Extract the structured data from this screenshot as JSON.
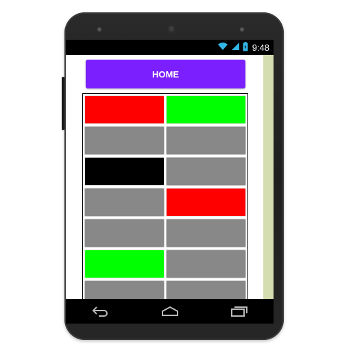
{
  "status_bar": {
    "time": "9:48",
    "icons": [
      "wifi-icon",
      "signal-icon",
      "battery-icon"
    ]
  },
  "app": {
    "home_label": "HOME",
    "home_color": "#7b1fff",
    "scroll_strip_color": "#d4ddb0"
  },
  "grid": {
    "columns": 2,
    "cells": [
      [
        "#ff0000",
        "#00ff00"
      ],
      [
        "#888888",
        "#888888"
      ],
      [
        "#000000",
        "#888888"
      ],
      [
        "#888888",
        "#ff0000"
      ],
      [
        "#888888",
        "#888888"
      ],
      [
        "#00ff00",
        "#888888"
      ],
      [
        "#888888",
        "#888888"
      ]
    ]
  },
  "nav": {
    "icons": [
      "back-icon",
      "home-icon",
      "recents-icon"
    ]
  }
}
